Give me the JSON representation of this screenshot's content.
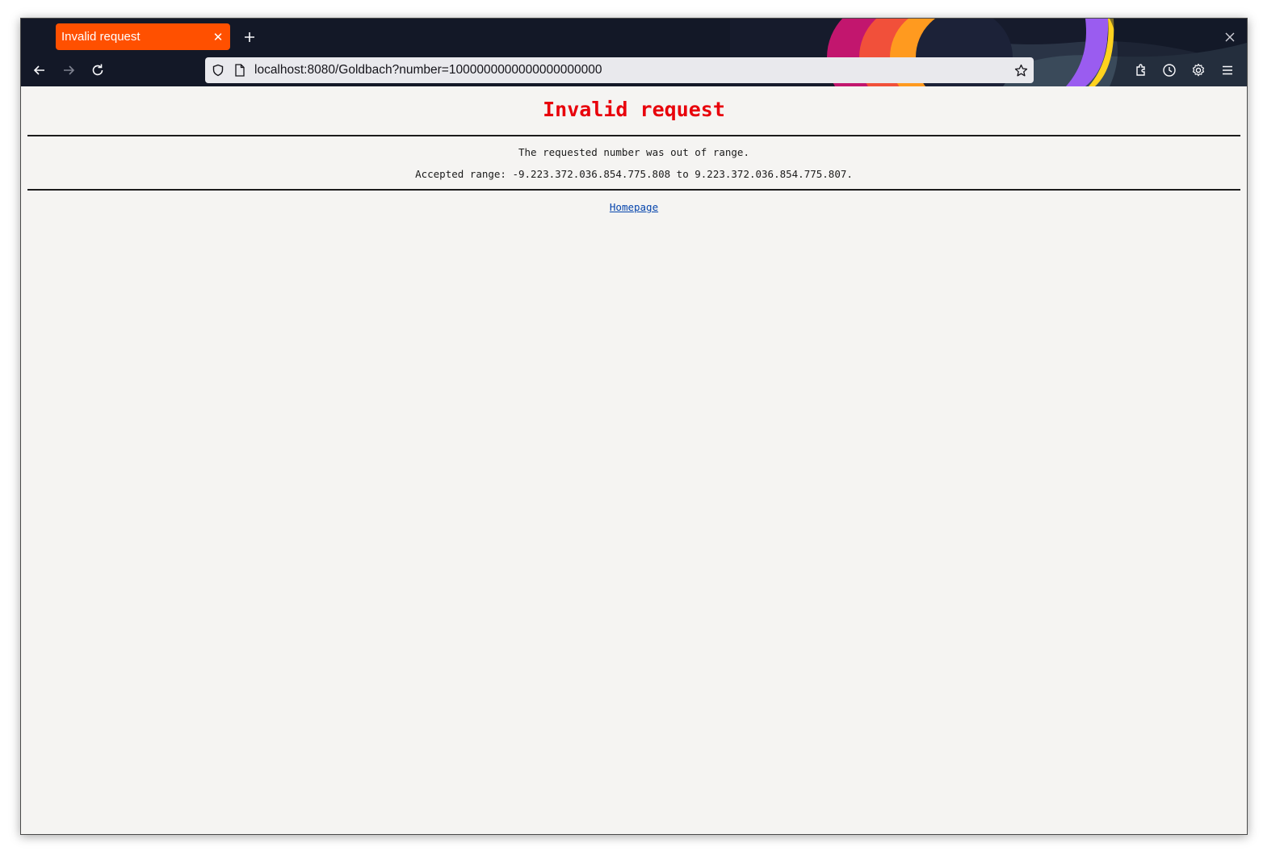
{
  "browser": {
    "tab": {
      "title": "Invalid request"
    },
    "url": "localhost:8080/Goldbach?number=1000000000000000000000"
  },
  "page": {
    "heading": "Invalid request",
    "message": "The requested number was out of range.",
    "range_text": "Accepted range: -9.223.372.036.854.775.808 to 9.223.372.036.854.775.807.",
    "homepage_link": "Homepage"
  },
  "colors": {
    "tab_active": "#ff5000",
    "heading": "#e8000b",
    "page_background": "#f5f4f2",
    "toolbar": "#131827"
  }
}
